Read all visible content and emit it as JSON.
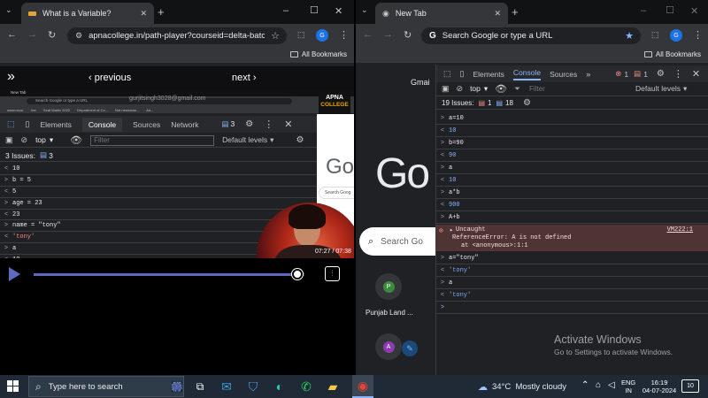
{
  "left_window": {
    "tab_title": "What is a Variable?",
    "url": "apnacollege.in/path-player?courseid=delta-batch-...",
    "bookmarks_label": "All Bookmarks",
    "nav": {
      "prev": "‹ previous",
      "next": "next ›"
    },
    "embedded": {
      "mini_tab": "New Tab",
      "mini_search": "Search Google or type a URL",
      "mini_bookmarks": [
        "www.mcur",
        "Jee",
        "Seat Matrix 2022",
        "Department of Co...",
        "Net newsnow...",
        "Ad..."
      ],
      "watermark_email": "gurjitsingh3028@gmail.com",
      "logo_line1": "APNA",
      "logo_line2": "COLLEGE",
      "devtools": {
        "tabs": [
          "Elements",
          "Console",
          "Sources",
          "Network"
        ],
        "issues_badge": "3",
        "context": "top",
        "filter_placeholder": "Filter",
        "levels": "Default levels",
        "issues_label": "3 Issues:",
        "issues_count": "3",
        "lines": [
          {
            "g": "<",
            "t": "10",
            "k": "out"
          },
          {
            "g": ">",
            "t": "b = 5",
            "k": "in"
          },
          {
            "g": "<",
            "t": "5",
            "k": "out"
          },
          {
            "g": ">",
            "t": "age = 23",
            "k": "in"
          },
          {
            "g": "<",
            "t": "23",
            "k": "out"
          },
          {
            "g": ">",
            "t": "name = \"tony\"",
            "k": "in"
          },
          {
            "g": "<",
            "t": "'tony'",
            "k": "str"
          },
          {
            "g": ">",
            "t": "a",
            "k": "in"
          },
          {
            "g": "<",
            "t": "10",
            "k": "out"
          }
        ]
      },
      "google_fragment": "Go",
      "search_fragment": "Search Goog",
      "video_time": "07:27 / 07:38"
    },
    "player": {
      "progress": 0.975
    }
  },
  "right_window": {
    "tab_title": "New Tab",
    "omnibox_placeholder": "Search Google or type a URL",
    "avatar_letter": "G",
    "bookmarks_label": "All Bookmarks",
    "account_email_fragment": "Gmai",
    "google_logo": "Go",
    "search_placeholder": "Search Go",
    "shortcuts": [
      {
        "letter": "P",
        "label": "Punjab Land ...",
        "color": "#3c8a3c"
      },
      {
        "letter": "A",
        "label": "",
        "color": "#8e3ab0"
      }
    ],
    "devtools": {
      "tabs": [
        "Elements",
        "Console",
        "Sources"
      ],
      "error_count": "1",
      "warn_count": "1",
      "context": "top",
      "filter_placeholder": "Filter",
      "levels": "Default levels",
      "issues_label": "19 Issues:",
      "issues_err": "1",
      "issues_info": "18",
      "lines": [
        {
          "g": ">",
          "t": "a=10",
          "k": "in"
        },
        {
          "g": "<",
          "t": "10",
          "k": "num"
        },
        {
          "g": ">",
          "t": "b=90",
          "k": "in"
        },
        {
          "g": "<",
          "t": "90",
          "k": "num"
        },
        {
          "g": ">",
          "t": "a",
          "k": "in"
        },
        {
          "g": "<",
          "t": "10",
          "k": "num"
        },
        {
          "g": ">",
          "t": "a*b",
          "k": "in"
        },
        {
          "g": "<",
          "t": "900",
          "k": "num"
        },
        {
          "g": ">",
          "t": "A+b",
          "k": "in"
        }
      ],
      "error": {
        "title": "Uncaught",
        "line2": "ReferenceError: A is not defined",
        "line3": "at <anonymous>:1:1",
        "source": "VM222:1"
      },
      "lines2": [
        {
          "g": ">",
          "t": "a=\"tony\"",
          "k": "in"
        },
        {
          "g": "<",
          "t": "'tony'",
          "k": "str"
        },
        {
          "g": ">",
          "t": "a",
          "k": "in"
        },
        {
          "g": "<",
          "t": "'tony'",
          "k": "str"
        },
        {
          "g": ">",
          "t": "",
          "k": "prompt"
        }
      ]
    },
    "activate_title": "Activate Windows",
    "activate_sub": "Go to Settings to activate Windows."
  },
  "taskbar": {
    "search_placeholder": "Type here to search",
    "weather": "34°C  Mostly cloudy",
    "lang1": "ENG",
    "lang2": "IN",
    "time": "16:19",
    "date": "04-07-2024",
    "notif_count": "10"
  }
}
